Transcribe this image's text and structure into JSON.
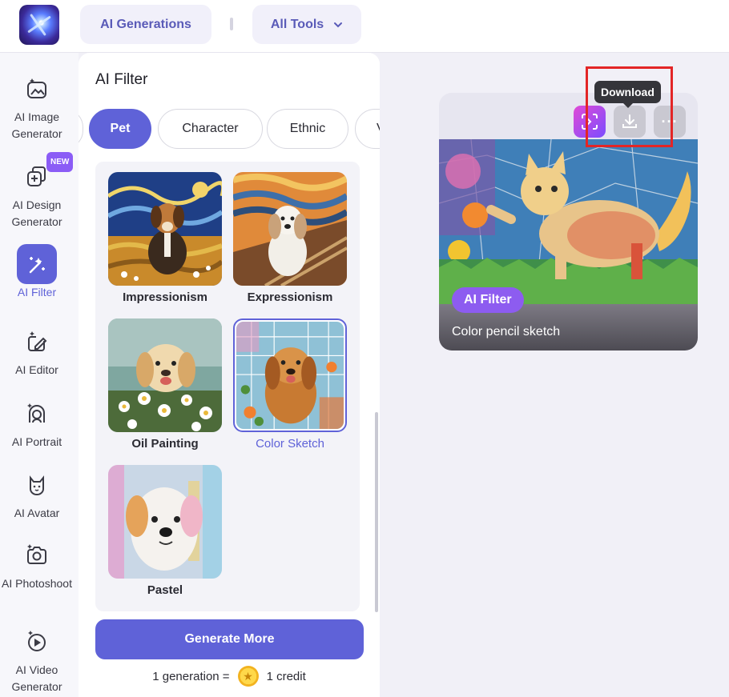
{
  "header": {
    "ai_generations_label": "AI Generations",
    "all_tools_label": "All Tools"
  },
  "sidebar": {
    "items": [
      {
        "label": "AI Image Generator",
        "icon": "image-sparkle-icon"
      },
      {
        "label": "AI Design Generator",
        "icon": "design-sparkle-icon",
        "badge": "NEW"
      },
      {
        "label": "AI Filter",
        "icon": "magic-wand-icon",
        "active": true
      },
      {
        "label": "AI Editor",
        "icon": "edit-sparkle-icon"
      },
      {
        "label": "AI Portrait",
        "icon": "portrait-icon"
      },
      {
        "label": "AI Avatar",
        "icon": "avatar-cat-icon"
      },
      {
        "label": "AI Photoshoot",
        "icon": "camera-sparkle-icon"
      },
      {
        "label": "AI Video Generator",
        "icon": "video-sparkle-icon"
      }
    ]
  },
  "panel": {
    "title": "AI Filter",
    "chips": [
      {
        "label": ""
      },
      {
        "label": "Pet",
        "active": true
      },
      {
        "label": "Character"
      },
      {
        "label": "Ethnic"
      },
      {
        "label": "V"
      }
    ],
    "styles": [
      {
        "label": "Impressionism"
      },
      {
        "label": "Expressionism"
      },
      {
        "label": "Oil Painting"
      },
      {
        "label": "Color Sketch",
        "selected": true
      },
      {
        "label": "Pastel"
      }
    ],
    "generate_label": "Generate More",
    "credit_left": "1 generation =",
    "credit_right": "1 credit"
  },
  "preview": {
    "tag": "AI Filter",
    "title": "Color pencil sketch",
    "tooltip": "Download",
    "more_label": "···"
  },
  "colors": {
    "accent": "#5f62d8",
    "tag": "#8d5cf0",
    "highlight": "#e32526"
  }
}
